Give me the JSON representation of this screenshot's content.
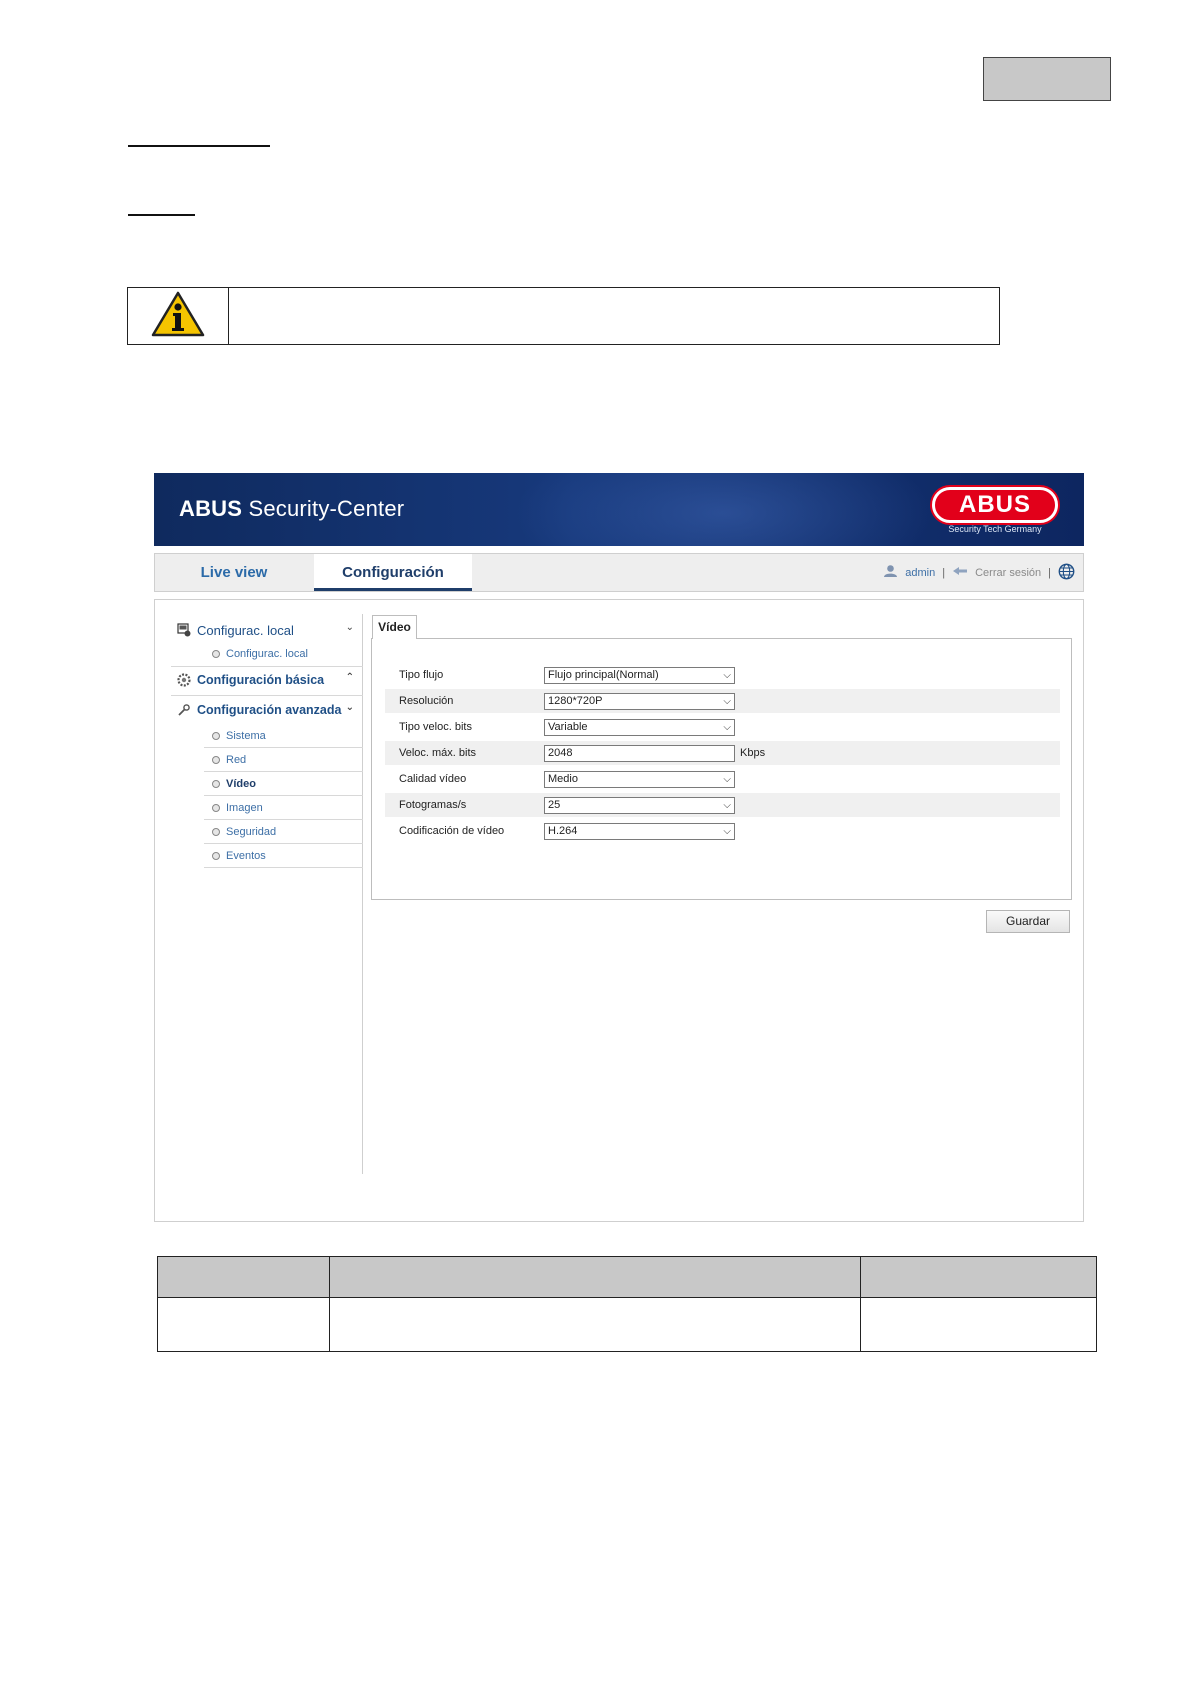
{
  "app": {
    "title_bold": "ABUS",
    "title_rest": " Security-Center",
    "logo_text": "ABUS",
    "logo_subtitle": "Security Tech Germany",
    "brand_color": "#e2001a",
    "banner_color": "#17397c"
  },
  "nav": {
    "tabs": [
      {
        "label": "Live view",
        "active": false
      },
      {
        "label": "Configuración",
        "active": true
      }
    ],
    "user_label": "admin",
    "separator": "|",
    "logout_label": "Cerrar sesión",
    "user_icon": "user-icon",
    "logout_icon": "logout-icon",
    "language_icon": "globe-icon"
  },
  "sidebar": {
    "groups": [
      {
        "label": "Configurac. local",
        "icon": "local-config-icon",
        "expanded": true
      },
      {
        "label": "Configuración básica",
        "icon": "gear-icon",
        "expanded": false
      },
      {
        "label": "Configuración avanzada",
        "icon": "wrench-icon",
        "expanded": true
      }
    ],
    "local_items": [
      {
        "label": "Configurac. local",
        "active": false
      }
    ],
    "advanced_items": [
      {
        "label": "Sistema",
        "active": false
      },
      {
        "label": "Red",
        "active": false
      },
      {
        "label": "Vídeo",
        "active": true
      },
      {
        "label": "Imagen",
        "active": false
      },
      {
        "label": "Seguridad",
        "active": false
      },
      {
        "label": "Eventos",
        "active": false
      }
    ]
  },
  "panel": {
    "tab_label": "Vídeo",
    "rows": [
      {
        "label": "Tipo flujo",
        "value": "Flujo principal(Normal)",
        "kind": "select"
      },
      {
        "label": "Resolución",
        "value": "1280*720P",
        "kind": "select"
      },
      {
        "label": "Tipo veloc. bits",
        "value": "Variable",
        "kind": "select"
      },
      {
        "label": "Veloc. máx. bits",
        "value": "2048",
        "kind": "input",
        "unit": "Kbps"
      },
      {
        "label": "Calidad vídeo",
        "value": "Medio",
        "kind": "select"
      },
      {
        "label": "Fotogramas/s",
        "value": "25",
        "kind": "select"
      },
      {
        "label": "Codificación de vídeo",
        "value": "H.264",
        "kind": "select"
      }
    ],
    "save_label": "Guardar"
  },
  "document": {
    "note_icon": "info-warning-icon"
  }
}
